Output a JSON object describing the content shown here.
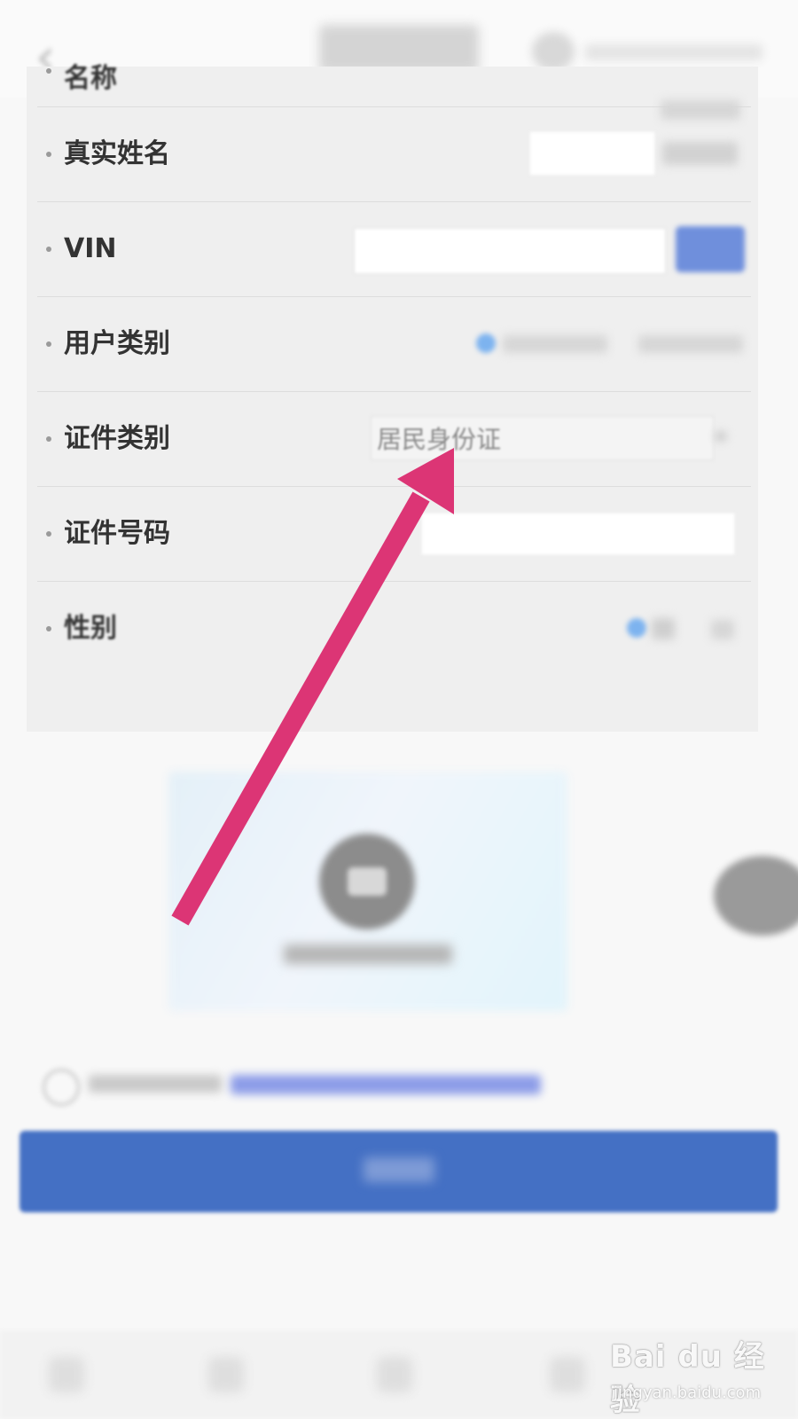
{
  "form": {
    "rows": [
      {
        "label": "名称"
      },
      {
        "label": "真实姓名"
      },
      {
        "label": "VIN"
      },
      {
        "label": "用户类别"
      },
      {
        "label": "证件类别",
        "select_value": "居民身份证"
      },
      {
        "label": "证件号码"
      },
      {
        "label": "性别"
      }
    ]
  },
  "colors": {
    "primary": "#4470c4",
    "annotation_arrow": "#dc3575",
    "radio_selected": "#7db3ef",
    "link": "#8c9ce8"
  },
  "icons": {
    "back": "chevron-left-icon",
    "camera": "camera-icon",
    "header_right": "user-icon"
  },
  "watermark": {
    "brand": "Bai du 经验",
    "url": "jingyan.baidu.com"
  }
}
